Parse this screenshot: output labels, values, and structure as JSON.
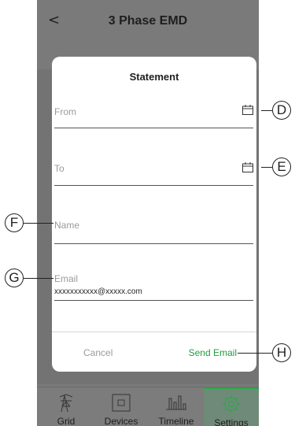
{
  "header": {
    "back_icon": "chevron-left-icon",
    "back_glyph": "<",
    "title": "3 Phase EMD"
  },
  "dialog": {
    "title": "Statement",
    "from": {
      "label": "From",
      "icon": "calendar-icon"
    },
    "to": {
      "label": "To",
      "icon": "calendar-icon"
    },
    "name": {
      "label": "Name",
      "value": ""
    },
    "email": {
      "label": "Email",
      "value": "xxxxxxxxxxx@xxxxx.com"
    },
    "cancel_label": "Cancel",
    "send_label": "Send Email"
  },
  "tabs": [
    {
      "label": "Grid",
      "icon": "transmission-tower-icon",
      "active": false
    },
    {
      "label": "Devices",
      "icon": "device-square-icon",
      "active": false
    },
    {
      "label": "Timeline",
      "icon": "bar-chart-icon",
      "active": false
    },
    {
      "label": "Settings",
      "icon": "gear-icon",
      "active": true
    }
  ],
  "callouts": [
    "D",
    "E",
    "F",
    "G",
    "H"
  ],
  "colors": {
    "accent": "#1e9e3e",
    "overlay": "#7a7a7a",
    "active_tab": "#2da84a"
  }
}
